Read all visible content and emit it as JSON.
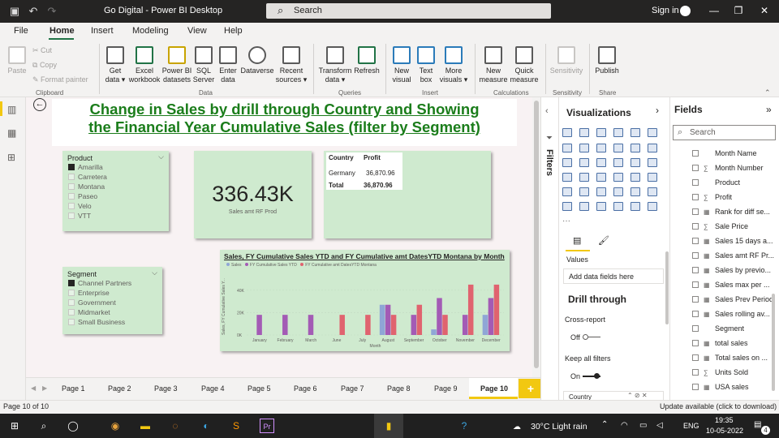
{
  "window": {
    "title": "Go Digital - Power BI Desktop",
    "search_placeholder": "Search",
    "sign_in": "Sign in"
  },
  "menu": {
    "items": [
      "File",
      "Home",
      "Insert",
      "Modeling",
      "View",
      "Help"
    ],
    "active": "Home"
  },
  "ribbon": {
    "clipboard": {
      "paste": "Paste",
      "cut": "Cut",
      "copy": "Copy",
      "format_painter": "Format painter",
      "group": "Clipboard"
    },
    "data": {
      "get_data": "Get data ▾",
      "excel": "Excel workbook",
      "pbi_datasets": "Power BI datasets",
      "sql": "SQL Server",
      "enter_data": "Enter data",
      "dataverse": "Dataverse",
      "recent": "Recent sources ▾",
      "group": "Data"
    },
    "queries": {
      "transform": "Transform data ▾",
      "refresh": "Refresh",
      "group": "Queries"
    },
    "insert": {
      "new_visual": "New visual",
      "text_box": "Text box",
      "more_visuals": "More visuals ▾",
      "group": "Insert"
    },
    "calculations": {
      "new_measure": "New measure",
      "quick_measure": "Quick measure",
      "group": "Calculations"
    },
    "sensitivity": {
      "label": "Sensitivity",
      "group": "Sensitivity"
    },
    "share": {
      "publish": "Publish",
      "group": "Share"
    }
  },
  "report": {
    "title_line1": "Change in Sales by drill through Country and Showing",
    "title_line2": "the Financial Year Cumulative Sales (filter by Segment)",
    "product_slicer": {
      "title": "Product",
      "items": [
        {
          "label": "Amarilla",
          "checked": true
        },
        {
          "label": "Carretera",
          "checked": false
        },
        {
          "label": "Montana",
          "checked": false
        },
        {
          "label": "Paseo",
          "checked": false
        },
        {
          "label": "Velo",
          "checked": false
        },
        {
          "label": "VTT",
          "checked": false
        }
      ]
    },
    "segment_slicer": {
      "title": "Segment",
      "items": [
        {
          "label": "Channel Partners",
          "checked": true
        },
        {
          "label": "Enterprise",
          "checked": false
        },
        {
          "label": "Government",
          "checked": false
        },
        {
          "label": "Midmarket",
          "checked": false
        },
        {
          "label": "Small Business",
          "checked": false
        }
      ]
    },
    "kpi": {
      "value": "336.43K",
      "label": "Sales amt RF Prod"
    },
    "table": {
      "headers": [
        "Country",
        "Profit"
      ],
      "rows": [
        [
          "Germany",
          "36,870.96"
        ]
      ],
      "total": [
        "Total",
        "36,870.96"
      ]
    }
  },
  "chart_data": {
    "type": "bar",
    "title": "Sales, FY Cumulative Sales YTD and FY Cumulative amt DatesYTD Montana by Month",
    "xlabel": "Month",
    "ylabel": "Sales, FY Cumulative Sales Y...",
    "ylim": [
      0,
      50000
    ],
    "yticks": [
      "0K",
      "20K",
      "40K"
    ],
    "legend_position": "top-left",
    "categories": [
      "January",
      "February",
      "March",
      "June",
      "July",
      "August",
      "September",
      "October",
      "November",
      "December"
    ],
    "series": [
      {
        "name": "Sales",
        "color": "#8fa6d6",
        "values": [
          0,
          0,
          0,
          0,
          0,
          27000,
          0,
          5000,
          0,
          18000
        ]
      },
      {
        "name": "FY Cumulative Sales YTD",
        "color": "#a35bb5",
        "values": [
          18000,
          18000,
          18000,
          0,
          0,
          27000,
          18000,
          33000,
          18000,
          33000
        ]
      },
      {
        "name": "FY Cumulative amt DatesYTD Montana",
        "color": "#e0636f",
        "values": [
          0,
          0,
          0,
          18000,
          18000,
          18000,
          27000,
          18000,
          45000,
          45000
        ]
      }
    ]
  },
  "pages": {
    "tabs": [
      "Page 1",
      "Page 2",
      "Page 3",
      "Page 4",
      "Page 5",
      "Page 6",
      "Page 7",
      "Page 8",
      "Page 9",
      "Page 10"
    ],
    "active": "Page 10",
    "add": "+"
  },
  "filters_label": "Filters",
  "visualizations": {
    "title": "Visualizations",
    "values_label": "Values",
    "add_fields": "Add data fields here",
    "drill_through": "Drill through",
    "cross_report": "Cross-report",
    "cross_report_state": "Off",
    "keep_filters": "Keep all filters",
    "keep_filters_state": "On",
    "country_field": "Country"
  },
  "fields": {
    "title": "Fields",
    "search_placeholder": "Search",
    "items": [
      {
        "label": "Month Name",
        "icon": ""
      },
      {
        "label": "Month Number",
        "icon": "∑"
      },
      {
        "label": "Product",
        "icon": ""
      },
      {
        "label": "Profit",
        "icon": "∑"
      },
      {
        "label": "Rank for diff se...",
        "icon": "▦"
      },
      {
        "label": "Sale Price",
        "icon": "∑"
      },
      {
        "label": "Sales 15 days a...",
        "icon": "▦"
      },
      {
        "label": "Sales amt RF Pr...",
        "icon": "▦"
      },
      {
        "label": "Sales by previo...",
        "icon": "▦"
      },
      {
        "label": "Sales max per ...",
        "icon": "▦"
      },
      {
        "label": "Sales Prev Period",
        "icon": "▦"
      },
      {
        "label": "Sales rolling av...",
        "icon": "▦"
      },
      {
        "label": "Segment",
        "icon": ""
      },
      {
        "label": "total sales",
        "icon": "▦"
      },
      {
        "label": "Total sales on ...",
        "icon": "▦"
      },
      {
        "label": "Units Sold",
        "icon": "∑"
      },
      {
        "label": "USA sales",
        "icon": "▦"
      }
    ]
  },
  "status": {
    "page_info": "Page 10 of 10",
    "update": "Update available (click to download)"
  },
  "taskbar": {
    "weather": "30°C  Light rain",
    "lang": "ENG",
    "time": "19:35",
    "date": "10-05-2022",
    "notifications": "4"
  },
  "colors": {
    "accent": "#f2c811",
    "card_bg": "#cfeacf",
    "title_green": "#1b7d1b"
  }
}
